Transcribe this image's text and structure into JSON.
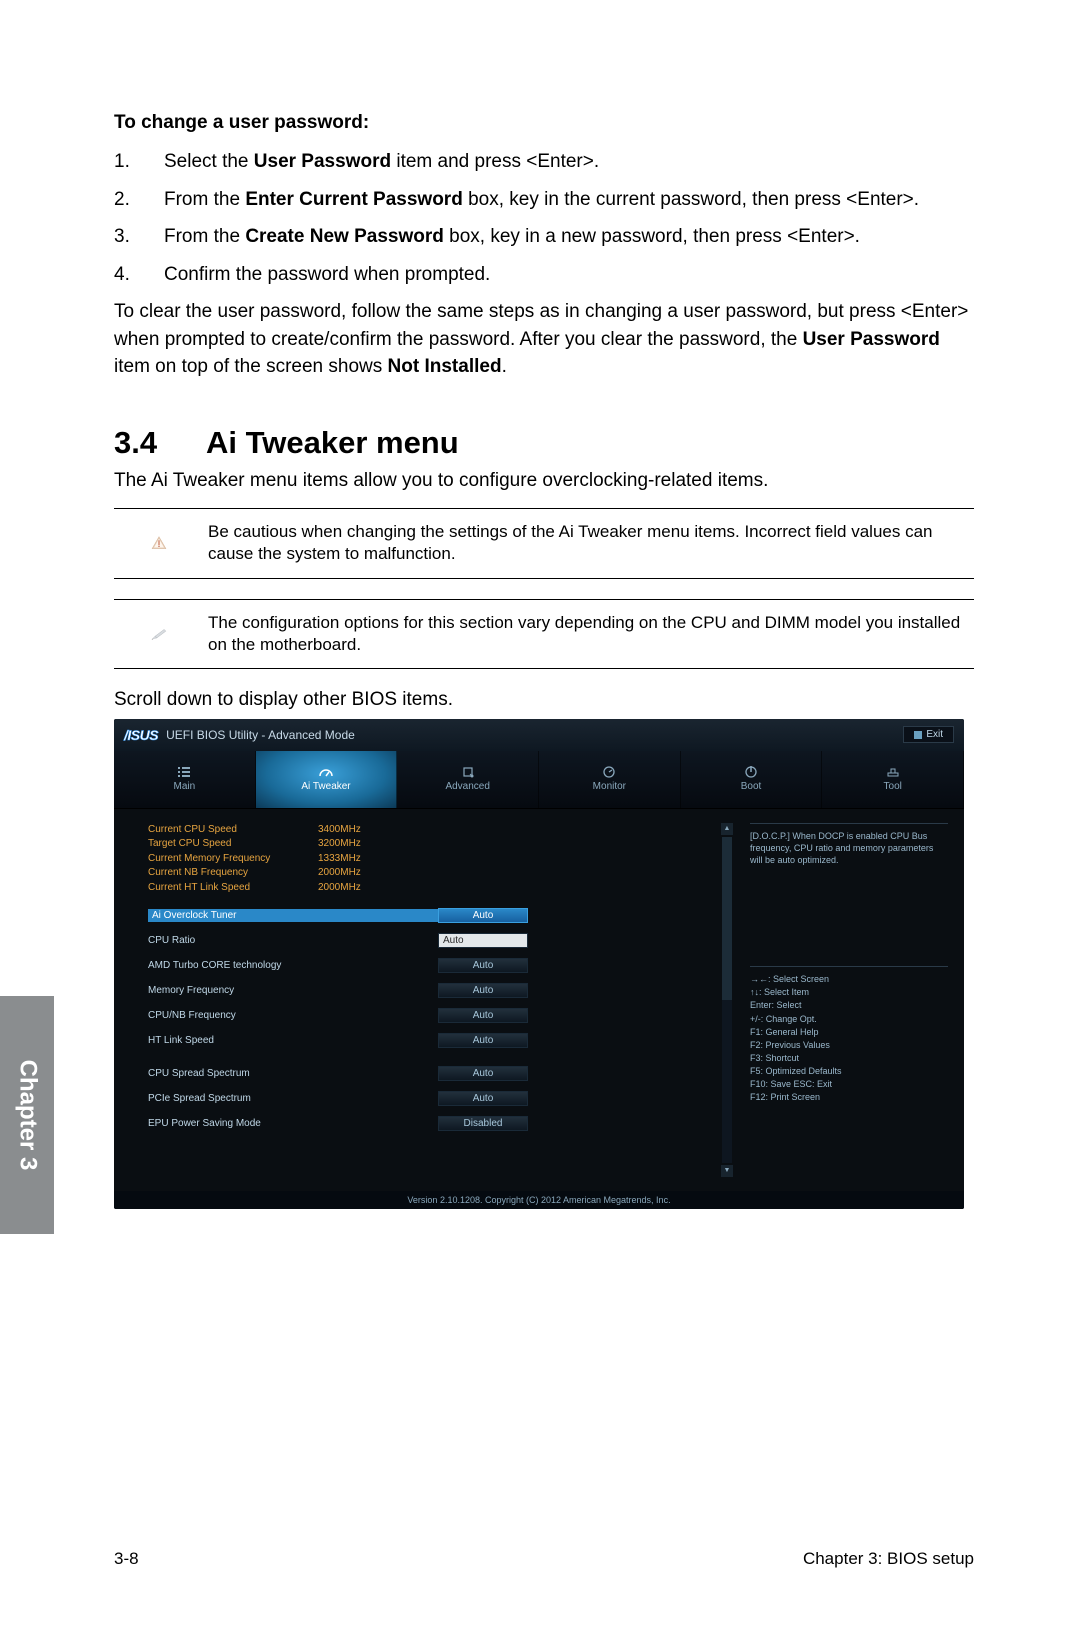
{
  "heading_change": "To change a user password:",
  "steps": [
    {
      "n": "1.",
      "pre": "Select the ",
      "b": "User Password",
      "post": " item and press <Enter>."
    },
    {
      "n": "2.",
      "pre": "From the ",
      "b": "Enter Current Password",
      "post": " box, key in the current password, then press <Enter>."
    },
    {
      "n": "3.",
      "pre": "From the ",
      "b": "Create New Password",
      "post": " box, key in a new password, then press <Enter>."
    },
    {
      "n": "4.",
      "pre": "",
      "b": "",
      "post": "Confirm the password when prompted."
    }
  ],
  "clear_text_1": "To clear the user password, follow the same steps as in changing a user password, but press <Enter> when prompted to create/confirm the password. After you clear the password, the ",
  "clear_bold_1": "User Password",
  "clear_text_2": " item on top of the screen shows ",
  "clear_bold_2": "Not Installed",
  "clear_text_3": ".",
  "section_num": "3.4",
  "section_title": "Ai Tweaker menu",
  "para_intro": "The Ai Tweaker menu items allow you to configure overclocking-related items.",
  "caution_text": "Be cautious when changing the settings of the Ai Tweaker menu items. Incorrect field values can cause the system to malfunction.",
  "note_text": "The configuration options for this section vary depending on the CPU and DIMM model you installed on the motherboard.",
  "scroll_line": "Scroll down to display other BIOS items.",
  "bios": {
    "brand": "/ISUS",
    "title": "UEFI BIOS Utility - Advanced Mode",
    "exit": "Exit",
    "tabs": [
      "Main",
      "Ai Tweaker",
      "Advanced",
      "Monitor",
      "Boot",
      "Tool"
    ],
    "active_tab": 1,
    "stats": [
      {
        "l": "Current CPU Speed",
        "v": "3400MHz"
      },
      {
        "l": "Target CPU Speed",
        "v": "3200MHz"
      },
      {
        "l": "Current Memory Frequency",
        "v": "1333MHz"
      },
      {
        "l": "Current NB Frequency",
        "v": "2000MHz"
      },
      {
        "l": "Current HT Link Speed",
        "v": "2000MHz"
      }
    ],
    "opts": [
      {
        "l": "Ai Overclock Tuner",
        "v": "Auto",
        "sel": true,
        "input": false
      },
      {
        "l": "CPU Ratio",
        "v": "Auto",
        "sel": false,
        "input": true
      },
      {
        "l": "AMD Turbo CORE technology",
        "v": "Auto",
        "sel": false,
        "input": false
      },
      {
        "l": "Memory Frequency",
        "v": "Auto",
        "sel": false,
        "input": false
      },
      {
        "l": "CPU/NB Frequency",
        "v": "Auto",
        "sel": false,
        "input": false
      },
      {
        "l": "HT Link Speed",
        "v": "Auto",
        "sel": false,
        "input": false
      },
      {
        "l": "CPU Spread Spectrum",
        "v": "Auto",
        "sel": false,
        "input": false
      },
      {
        "l": "PCIe Spread Spectrum",
        "v": "Auto",
        "sel": false,
        "input": false
      },
      {
        "l": "EPU Power Saving Mode",
        "v": "Disabled",
        "sel": false,
        "input": false
      }
    ],
    "side_desc": "[D.O.C.P.] When DOCP is enabled CPU Bus frequency, CPU ratio and memory parameters will be auto optimized.",
    "side_help": [
      "→←: Select Screen",
      "↑↓: Select Item",
      "Enter: Select",
      "+/-: Change Opt.",
      "F1: General Help",
      "F2: Previous Values",
      "F3: Shortcut",
      "F5: Optimized Defaults",
      "F10: Save   ESC: Exit",
      "F12: Print Screen"
    ],
    "footer": "Version 2.10.1208. Copyright (C) 2012 American Megatrends, Inc."
  },
  "chapter_tab": "Chapter 3",
  "page_num": "3-8",
  "page_title": "Chapter 3: BIOS setup"
}
